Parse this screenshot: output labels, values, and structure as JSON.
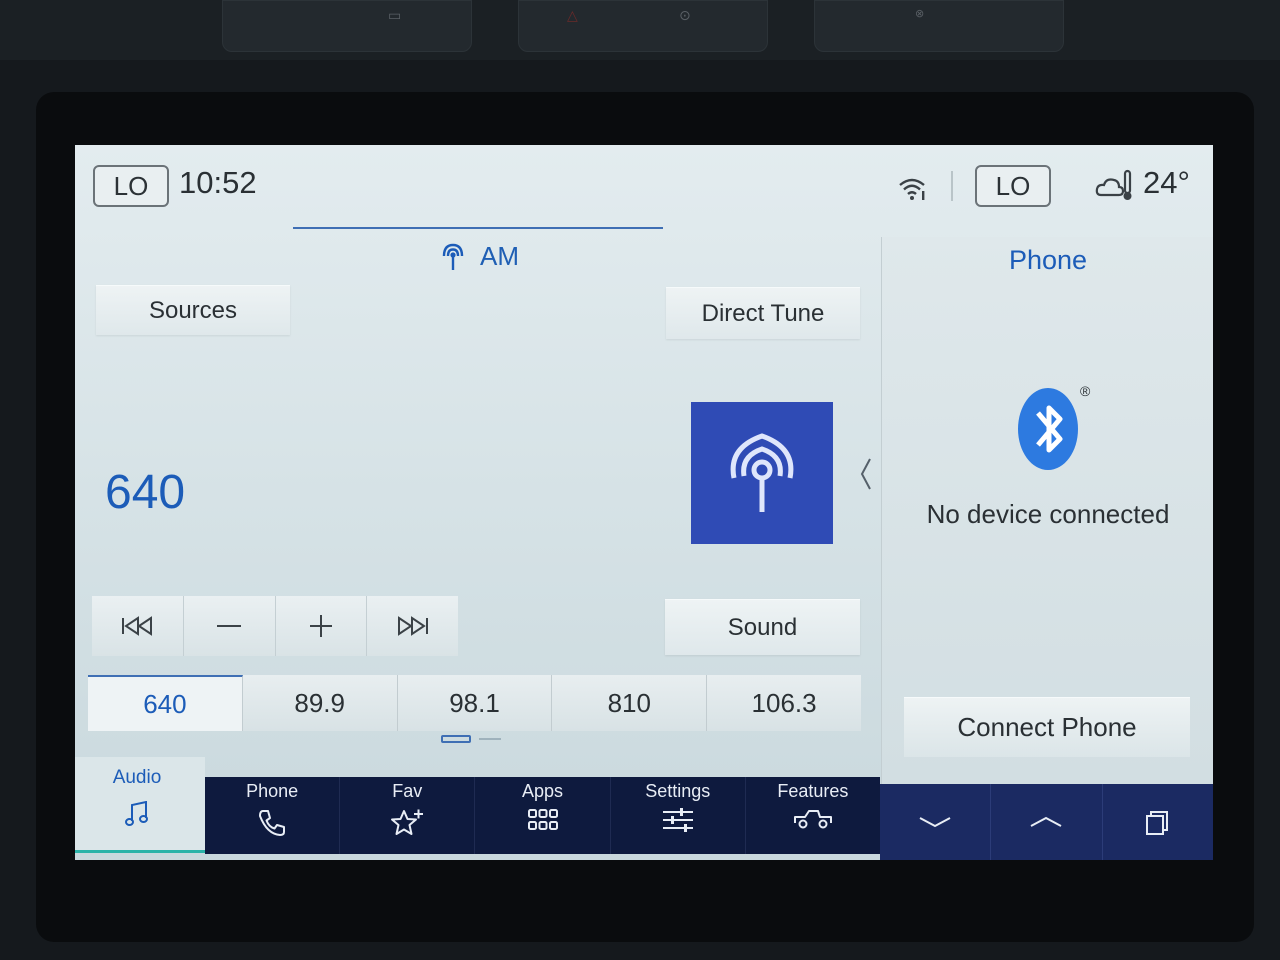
{
  "status_bar": {
    "left_climate": "LO",
    "time": "10:52",
    "right_climate": "LO",
    "temperature": "24°",
    "icons": [
      "wifi-icon",
      "cloud-thermometer-icon"
    ]
  },
  "audio": {
    "source_label": "AM",
    "sources_label": "Sources",
    "direct_tune_label": "Direct Tune",
    "current_frequency": "640",
    "sound_label": "Sound",
    "transport_icons": [
      "seek-back-icon",
      "minus-icon",
      "plus-icon",
      "seek-forward-icon"
    ],
    "presets": [
      "640",
      "89.9",
      "98.1",
      "810",
      "106.3"
    ],
    "active_preset_index": 0
  },
  "phone": {
    "title": "Phone",
    "registered_mark": "®",
    "status": "No device connected",
    "connect_label": "Connect Phone"
  },
  "nav": {
    "audio_label": "Audio",
    "items": [
      {
        "label": "Phone",
        "icon": "phone-icon"
      },
      {
        "label": "Fav",
        "icon": "star-plus-icon"
      },
      {
        "label": "Apps",
        "icon": "apps-grid-icon"
      },
      {
        "label": "Settings",
        "icon": "sliders-icon"
      },
      {
        "label": "Features",
        "icon": "truck-icon"
      }
    ],
    "right_icons": [
      "chevron-down-icon",
      "chevron-up-icon",
      "windows-icon"
    ]
  },
  "colors": {
    "accent": "#1c5cb8",
    "nav_dark": "#0e1a3e",
    "album_art": "#2f4bb5",
    "active_underline": "#2ab3a8"
  }
}
